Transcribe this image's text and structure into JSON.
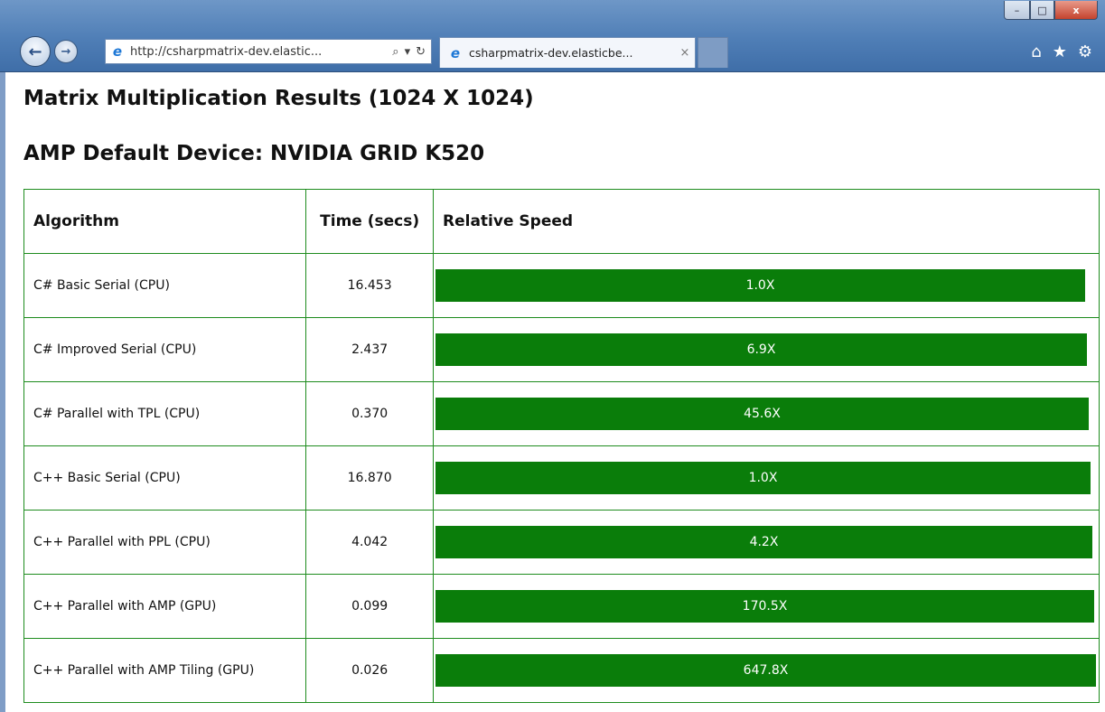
{
  "browser": {
    "address": "http://csharpmatrix-dev.elastic...",
    "tab_title": "csharpmatrix-dev.elasticbe...",
    "tab_close": "×",
    "win_min": "–",
    "win_max": "□",
    "win_close": "x",
    "back": "←",
    "forward": "→",
    "search_glyph": "⌕",
    "dropdown_glyph": "▾",
    "refresh_glyph": "↻",
    "home_glyph": "⌂",
    "star_glyph": "★",
    "gear_glyph": "⚙"
  },
  "page": {
    "title": "Matrix Multiplication Results (1024 X 1024)",
    "subtitle": "AMP Default Device: NVIDIA GRID K520"
  },
  "table": {
    "headers": [
      "Algorithm",
      "Time (secs)",
      "Relative Speed"
    ],
    "max_speed": 647.8,
    "bar_color": "#0a7d0a",
    "rows": [
      {
        "algorithm": "C# Basic Serial (CPU)",
        "time": "16.453",
        "speed": 1.0,
        "speed_label": "1.0X"
      },
      {
        "algorithm": "C# Improved Serial (CPU)",
        "time": "2.437",
        "speed": 6.9,
        "speed_label": "6.9X"
      },
      {
        "algorithm": "C# Parallel with TPL (CPU)",
        "time": "0.370",
        "speed": 45.6,
        "speed_label": "45.6X"
      },
      {
        "algorithm": "C++ Basic Serial (CPU)",
        "time": "16.870",
        "speed": 1.0,
        "speed_label": "1.0X"
      },
      {
        "algorithm": "C++ Parallel with PPL (CPU)",
        "time": "4.042",
        "speed": 4.2,
        "speed_label": "4.2X"
      },
      {
        "algorithm": "C++ Parallel with AMP (GPU)",
        "time": "0.099",
        "speed": 170.5,
        "speed_label": "170.5X"
      },
      {
        "algorithm": "C++ Parallel with AMP Tiling (GPU)",
        "time": "0.026",
        "speed": 647.8,
        "speed_label": "647.8X"
      }
    ]
  }
}
